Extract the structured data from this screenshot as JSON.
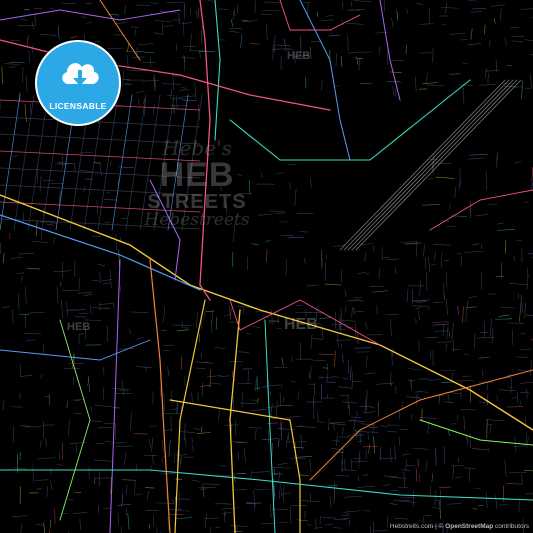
{
  "map": {
    "style": "dark-multicolor-streets",
    "background_color": "#000000",
    "road_colors": [
      "#ff5a8a",
      "#ffd23a",
      "#5aa7ff",
      "#3de8d2",
      "#ff8a3a",
      "#b46aff",
      "#8aff6a"
    ],
    "minor_road_color": "#3a4560"
  },
  "badge": {
    "label": "LICENSABLE",
    "icon": "cloud-download-icon",
    "color": "#2da8e6"
  },
  "watermarks": {
    "heb": "HEB",
    "streets": "STREETS",
    "script_top": "Hebe's",
    "script_bottom": "Hebestreets"
  },
  "attribution": {
    "site": "Hebstreits.com",
    "separator": " | © ",
    "osm": "OpenStreetMap",
    "contributors": " contributors"
  }
}
